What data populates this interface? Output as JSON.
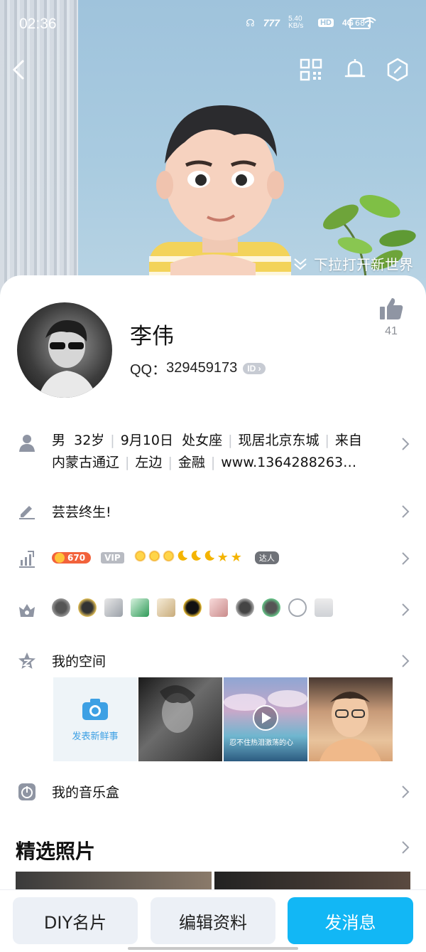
{
  "status": {
    "time": "02:36",
    "net_speed": "5.40\nKB/s",
    "hd": "HD",
    "network": "4G",
    "battery": "68"
  },
  "cover": {
    "pull_hint": "下拉打开新世界"
  },
  "profile": {
    "name": "李伟",
    "qq_label": "QQ：",
    "qq_number": "329459173",
    "id_badge": "ID",
    "like_count": "41"
  },
  "info": {
    "gender": "男",
    "age": "32岁",
    "birthday": "9月10日",
    "zodiac": "处女座",
    "residence": "现居北京东城",
    "from": "来自",
    "line2_hometown": "内蒙古通辽",
    "line2_blood": "左边",
    "line2_job": "金融",
    "line2_site": "www.1364288263…"
  },
  "signature": {
    "text": "芸芸终生!"
  },
  "level": {
    "coins": "670",
    "vip": "VIP",
    "talent": "达人"
  },
  "space": {
    "title": "我的空间",
    "post_label": "发表新鲜事",
    "sea_caption": "忍不住热泪激荡的心"
  },
  "music": {
    "title": "我的音乐盒"
  },
  "photos": {
    "title": "精选照片"
  },
  "actions": {
    "diy": "DIY名片",
    "edit": "编辑资料",
    "message": "发消息"
  },
  "colors": {
    "accent": "#12b7f5",
    "button_bg": "#ecf0f6",
    "icon_gray": "#8f95a3"
  }
}
